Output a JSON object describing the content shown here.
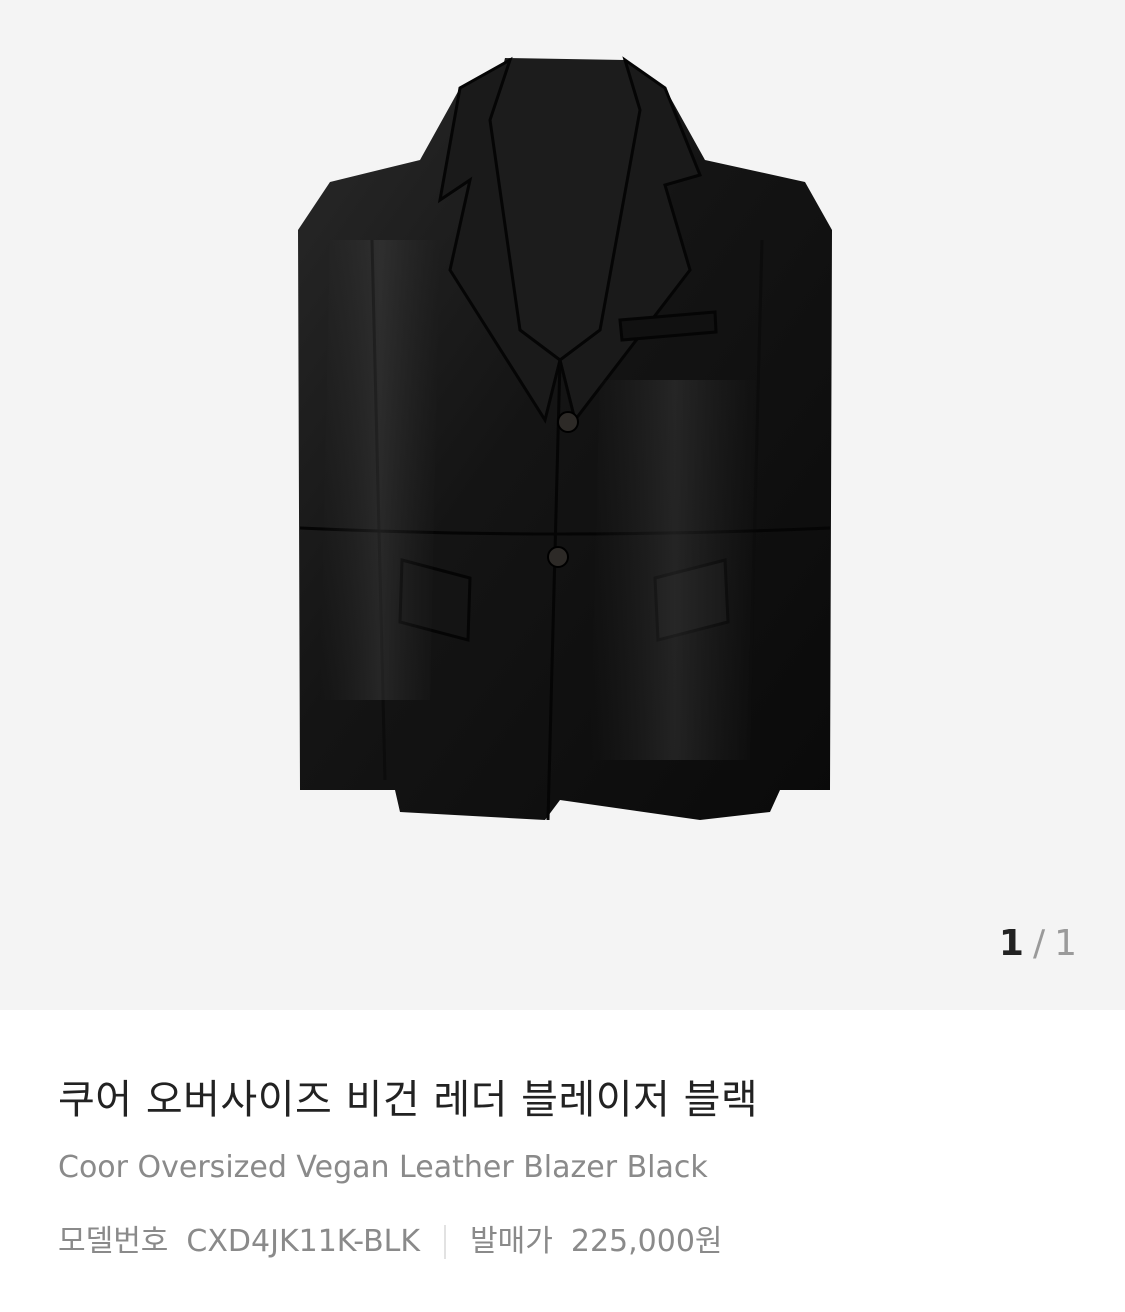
{
  "gallery": {
    "image_alt": "Black oversized vegan leather blazer",
    "pager": {
      "current": "1",
      "separator": "/",
      "total": "1"
    }
  },
  "product": {
    "name_ko": "쿠어 오버사이즈 비건 레더 블레이저 블랙",
    "name_en": "Coor Oversized Vegan Leather Blazer Black",
    "model_label": "모델번호",
    "model_value": "CXD4JK11K-BLK",
    "release_price_label": "발매가",
    "release_price_value": "225,000원"
  }
}
